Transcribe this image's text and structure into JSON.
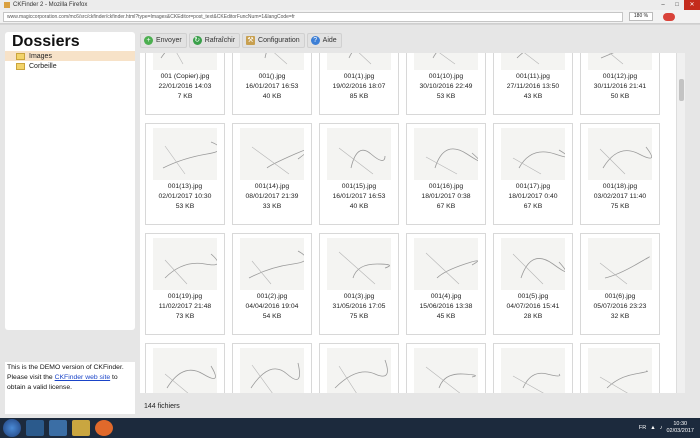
{
  "browser": {
    "title": "CKFinder 2 - Mozilla Firefox",
    "url": "www.magiccorporation.com/mc6/src/ckfinder/ckfinder.html?type=Images&CKEditor=post_text&CKEditorFuncNum=1&langCode=fr",
    "zoom": "180 %"
  },
  "sidebar": {
    "heading": "Dossiers",
    "folders": [
      {
        "label": "Images"
      },
      {
        "label": "Corbeille"
      }
    ]
  },
  "toolbar": {
    "upload": "Envoyer",
    "refresh": "Rafraîchir",
    "settings": "Configuration",
    "help": "Aide"
  },
  "files": [
    {
      "name": "001 (Copier).jpg",
      "date": "22/01/2016 14:03",
      "size": "7 KB"
    },
    {
      "name": "001().jpg",
      "date": "16/01/2017 16:53",
      "size": "40 KB"
    },
    {
      "name": "001(1).jpg",
      "date": "19/02/2016 18:07",
      "size": "85 KB"
    },
    {
      "name": "001(10).jpg",
      "date": "30/10/2016 22:49",
      "size": "53 KB"
    },
    {
      "name": "001(11).jpg",
      "date": "27/11/2016 13:50",
      "size": "43 KB"
    },
    {
      "name": "001(12).jpg",
      "date": "30/11/2016 21:41",
      "size": "50 KB"
    },
    {
      "name": "001(13).jpg",
      "date": "02/01/2017 10:30",
      "size": "53 KB"
    },
    {
      "name": "001(14).jpg",
      "date": "08/01/2017 21:39",
      "size": "33 KB"
    },
    {
      "name": "001(15).jpg",
      "date": "16/01/2017 16:53",
      "size": "40 KB"
    },
    {
      "name": "001(16).jpg",
      "date": "18/01/2017 0:38",
      "size": "67 KB"
    },
    {
      "name": "001(17).jpg",
      "date": "18/01/2017 0:40",
      "size": "67 KB"
    },
    {
      "name": "001(18).jpg",
      "date": "03/02/2017 11:40",
      "size": "75 KB"
    },
    {
      "name": "001(19).jpg",
      "date": "11/02/2017 21:48",
      "size": "73 KB"
    },
    {
      "name": "001(2).jpg",
      "date": "04/04/2016 19:04",
      "size": "54 KB"
    },
    {
      "name": "001(3).jpg",
      "date": "31/05/2016 17:05",
      "size": "75 KB"
    },
    {
      "name": "001(4).jpg",
      "date": "15/06/2016 13:38",
      "size": "45 KB"
    },
    {
      "name": "001(5).jpg",
      "date": "04/07/2016 15:41",
      "size": "28 KB"
    },
    {
      "name": "001(6).jpg",
      "date": "05/07/2016 23:23",
      "size": "32 KB"
    },
    {
      "name": "",
      "date": "",
      "size": ""
    },
    {
      "name": "",
      "date": "",
      "size": ""
    },
    {
      "name": "",
      "date": "",
      "size": ""
    },
    {
      "name": "",
      "date": "",
      "size": ""
    },
    {
      "name": "",
      "date": "",
      "size": ""
    },
    {
      "name": "",
      "date": "",
      "size": ""
    }
  ],
  "status": {
    "count": "144 fichiers"
  },
  "demo_notice": {
    "line1": "This is the DEMO version of CKFinder.",
    "line2_pre": "Please visit the",
    "link": "CKFinder web site",
    "line2_post": "to",
    "line3": "obtain a valid license."
  },
  "taskbar": {
    "lang": "FR",
    "time": "10:30",
    "date": "02/03/2017"
  },
  "colors": {
    "accent_link": "#1a44c8",
    "selected_folder": "#f7e2c8",
    "taskbar": "#1c2a3d"
  }
}
